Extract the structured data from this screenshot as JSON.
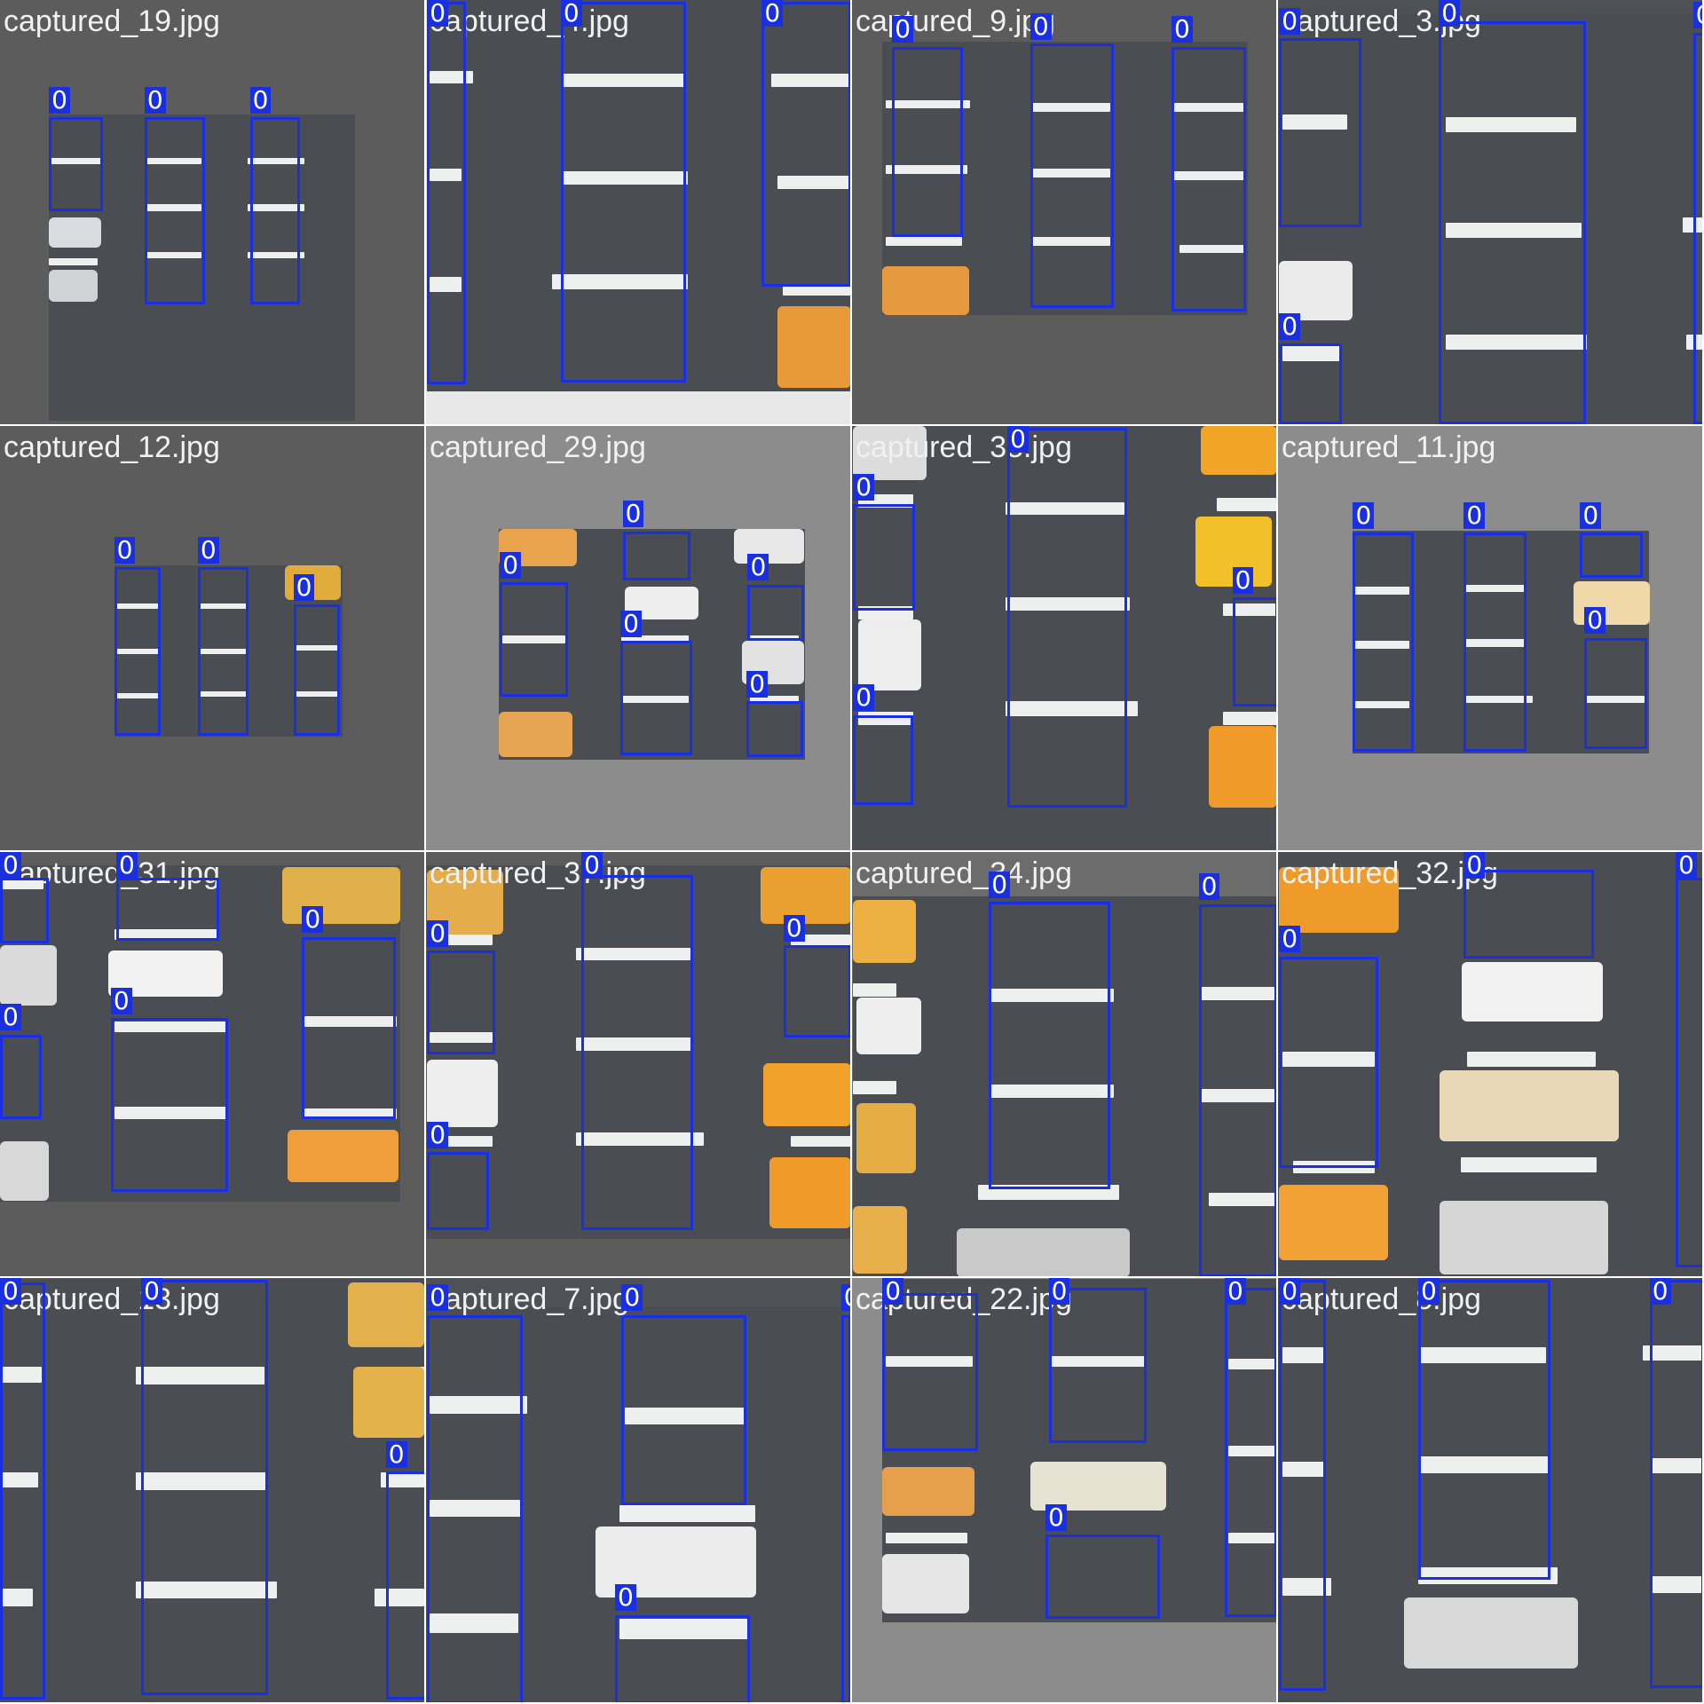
{
  "mosaic": {
    "class_label": "0",
    "box_color": "#1a2fe0",
    "tiles": [
      {
        "file": "captured_19.jpg",
        "boxes": 3
      },
      {
        "file": "captured_4.jpg",
        "boxes": 3
      },
      {
        "file": "captured_9.jpg",
        "boxes": 3
      },
      {
        "file": "captured_3.jpg",
        "boxes": 4
      },
      {
        "file": "captured_12.jpg",
        "boxes": 3
      },
      {
        "file": "captured_29.jpg",
        "boxes": 5
      },
      {
        "file": "captured_38.jpg",
        "boxes": 4
      },
      {
        "file": "captured_11.jpg",
        "boxes": 4
      },
      {
        "file": "captured_31.jpg",
        "boxes": 5
      },
      {
        "file": "captured_37.jpg",
        "boxes": 4
      },
      {
        "file": "captured_34.jpg",
        "boxes": 2
      },
      {
        "file": "captured_32.jpg",
        "boxes": 3
      },
      {
        "file": "captured_13.jpg",
        "boxes": 3
      },
      {
        "file": "captured_7.jpg",
        "boxes": 4
      },
      {
        "file": "captured_22.jpg",
        "boxes": 4
      },
      {
        "file": "captured_8.jpg",
        "boxes": 3
      }
    ]
  }
}
